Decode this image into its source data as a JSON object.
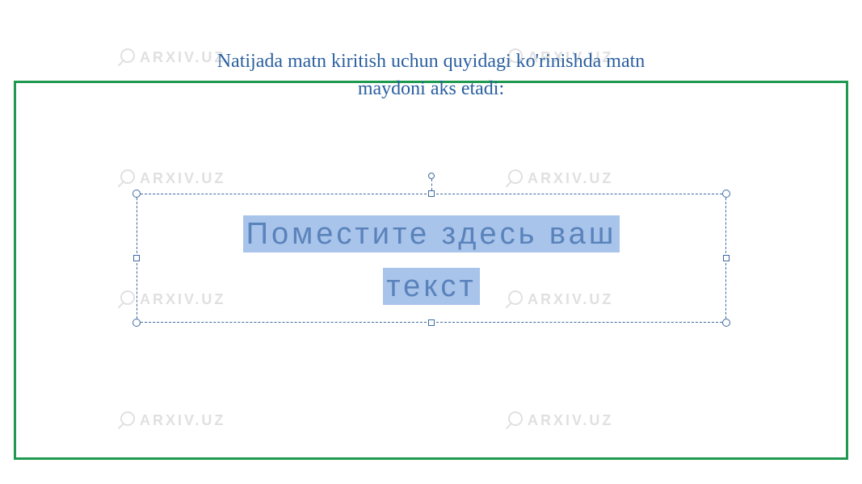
{
  "watermark_text": "ARXIV.UZ",
  "title_line1": "Natijada matn kiritish uchun quyidagi ko'rinishda matn",
  "title_line2": "maydoni aks etadi:",
  "placeholder_line1": "Поместите здесь ваш",
  "placeholder_line2": "текст"
}
